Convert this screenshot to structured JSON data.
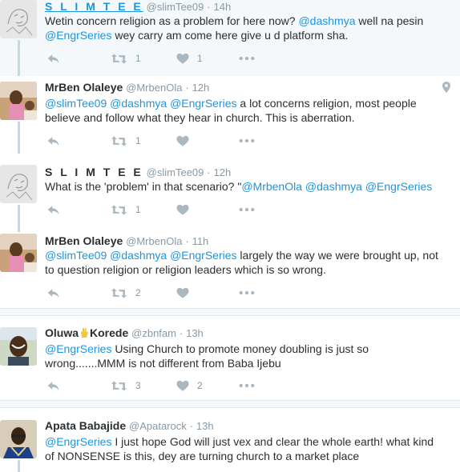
{
  "tweets": [
    {
      "name": "S L I M T E E",
      "handle": "@slimTee09",
      "sep": "·",
      "time": "14h",
      "line1_pre": "Wetin concern religion as a problem for here now? ",
      "line1_m1": "@dashmya",
      "line1_post": " well na pesin",
      "line2_m1": "@EngrSeries",
      "line2_post": " wey carry am come here give u d platform sha.",
      "retweets": "1",
      "likes": "1"
    },
    {
      "name": "MrBen Olaleye",
      "handle": "@MrbenOla",
      "sep": "·",
      "time": "12h",
      "line1_m1": "@slimTee09",
      "line1_m2": "@dashmya",
      "line1_m3": "@EngrSeries",
      "line1_post": " a lot concerns religion, most people",
      "line2": "believe and follow what they hear in church. This is aberration.",
      "retweets": "1"
    },
    {
      "name": "S L I M T E E",
      "handle": "@slimTee09",
      "sep": "·",
      "time": "12h",
      "line1_pre": "What is the 'problem' in that scenario? \"",
      "line1_m1": "@MrbenOla",
      "line1_m2": "@dashmya",
      "line1_m3": "@EngrSeries",
      "retweets": "1"
    },
    {
      "name": "MrBen Olaleye",
      "handle": "@MrbenOla",
      "sep": "·",
      "time": "11h",
      "line1_m1": "@slimTee09",
      "line1_m2": "@dashmya",
      "line1_m3": "@EngrSeries",
      "line1_post": " largely the way we were brought up, not",
      "line2": "to question religion or religion leaders which is so wrong.",
      "retweets": "2"
    },
    {
      "name_a": "Oluwa",
      "name_b": "Korede",
      "handle": "@zbnfam",
      "sep": "·",
      "time": "13h",
      "line1_m1": "@EngrSeries",
      "line1_post": " Using Church to promote money doubling is just so",
      "line2": "wrong.......MMM is not different from Baba Ijebu",
      "retweets": "3",
      "likes": "2"
    },
    {
      "name": "Apata Babajide",
      "handle": "@Apatarock",
      "sep": "·",
      "time": "13h",
      "line1_m1": "@EngrSeries",
      "line1_post": " I just hope God will just vex and clear the whole earth! what kind",
      "line2": "of NONSENSE is this, dey are turning church to a market place"
    }
  ],
  "icons": {
    "reply": "reply-icon",
    "retweet": "retweet-icon",
    "like": "heart-icon",
    "more": "more-icon",
    "location": "location-pin-icon",
    "emoji": "fist-bump-emoji-icon"
  },
  "colors": {
    "link": "#1b95e0",
    "muted": "#8899a6",
    "icon": "#aab8c2",
    "thread_line": "#ccd6dd",
    "highlight_bg": "#f5f8fa"
  }
}
